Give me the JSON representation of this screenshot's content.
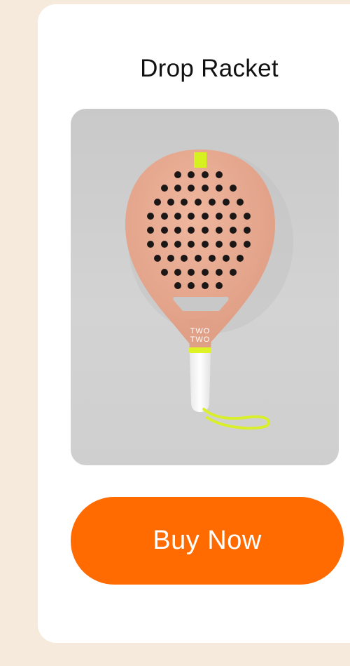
{
  "product": {
    "name": "Drop Racket",
    "image_alt": "Drop Racket padel racket",
    "racket_brand_text": [
      "TWO",
      "TWO"
    ]
  },
  "actions": {
    "buy_label": "Buy Now"
  },
  "colors": {
    "background": "#f5eadc",
    "card": "#ffffff",
    "accent": "#ff6b00",
    "racket": "#e8aa90",
    "grip": "#ffffff",
    "cord": "#d8ef2a"
  }
}
